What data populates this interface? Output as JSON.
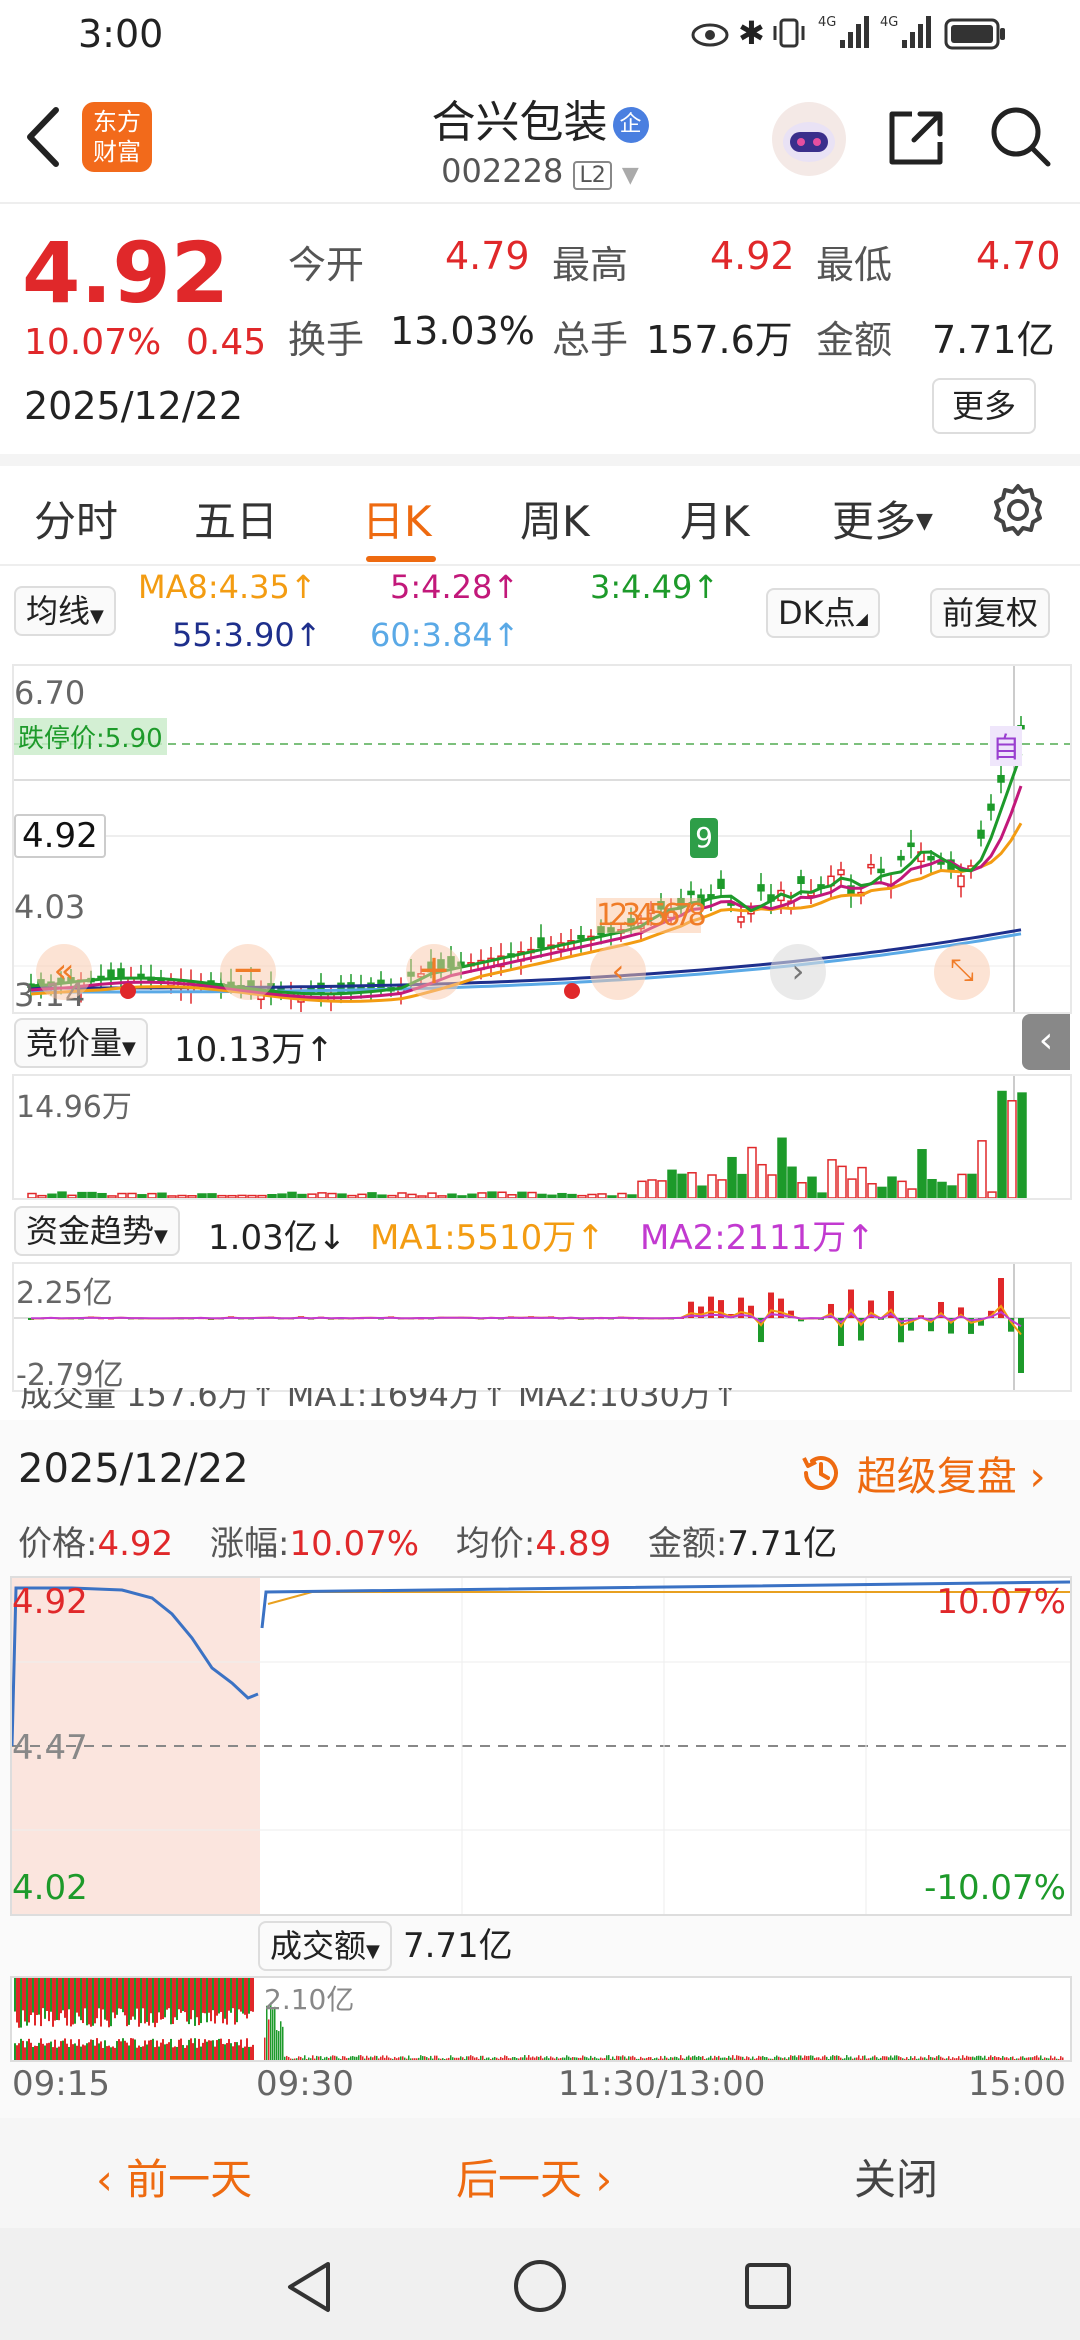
{
  "status": {
    "time": "3:00",
    "net1": "4G",
    "net2": "4G"
  },
  "header": {
    "stock_name": "合兴包装",
    "enterprise_badge": "企",
    "stock_code": "002228",
    "level_badge": "L2",
    "logo_line1": "东方",
    "logo_line2": "财富"
  },
  "quote": {
    "price": "4.92",
    "change_pct": "10.07%",
    "change_amt": "0.45",
    "date": "2025/12/22",
    "open_label": "今开",
    "open": "4.79",
    "high_label": "最高",
    "high": "4.92",
    "low_label": "最低",
    "low": "4.70",
    "turnover_label": "换手",
    "turnover": "13.03%",
    "volume_label": "总手",
    "volume": "157.6万",
    "amount_label": "金额",
    "amount": "7.71亿",
    "more_button": "更多"
  },
  "tabs": [
    {
      "label": "分时"
    },
    {
      "label": "五日"
    },
    {
      "label": "日K"
    },
    {
      "label": "周K"
    },
    {
      "label": "月K"
    },
    {
      "label": "更多"
    }
  ],
  "kline": {
    "ma_selector": "均线",
    "ma8": "MA8:4.35↑",
    "ma5": "5:4.28↑",
    "ma3": "3:4.49↑",
    "ma55": "55:3.90↑",
    "ma60": "60:3.84↑",
    "dk_button": "DK点",
    "adjust_button": "前复权",
    "y_top": "6.70",
    "y_mid": "4.92",
    "y_low": "4.03",
    "y_bottom": "3.14",
    "limit_down_label": "跌停价:5.90",
    "signal_9": "9",
    "signal_nums": "12345678",
    "self_label": "自",
    "colors": {
      "ma8": "#f39c12",
      "ma5": "#c2187a",
      "ma3": "#1d9a2a",
      "ma55": "#1e2f8c",
      "ma60": "#5aa9e6",
      "up": "#e0282a",
      "down": "#1d9a2a"
    }
  },
  "auction": {
    "selector": "竞价量",
    "value": "10.13万↑",
    "max": "14.96万"
  },
  "fund": {
    "selector": "资金趋势",
    "value": "1.03亿↓",
    "ma1": "MA1:5510万↑",
    "ma2": "MA2:2111万↑",
    "top": "2.25亿",
    "bottom": "-2.79亿",
    "peek": "成交量  157.6万↑  MA1:1694万↑  MA2:1030万↑"
  },
  "detail": {
    "date": "2025/12/22",
    "replay": "超级复盘",
    "price_label": "价格:",
    "price": "4.92",
    "pct_label": "涨幅:",
    "pct": "10.07%",
    "avg_label": "均价:",
    "avg": "4.89",
    "amt_label": "金额:",
    "amt": "7.71亿",
    "y_top": "4.92",
    "y_mid": "4.47",
    "y_bottom": "4.02",
    "pct_top": "10.07%",
    "pct_bottom": "-10.07%",
    "vol_selector": "成交额",
    "vol_value": "7.71亿",
    "vol_max": "2.10亿",
    "times": [
      "09:15",
      "09:30",
      "11:30/13:00",
      "15:00"
    ]
  },
  "footer": {
    "prev": "前一天",
    "next": "后一天",
    "close": "关闭"
  }
}
